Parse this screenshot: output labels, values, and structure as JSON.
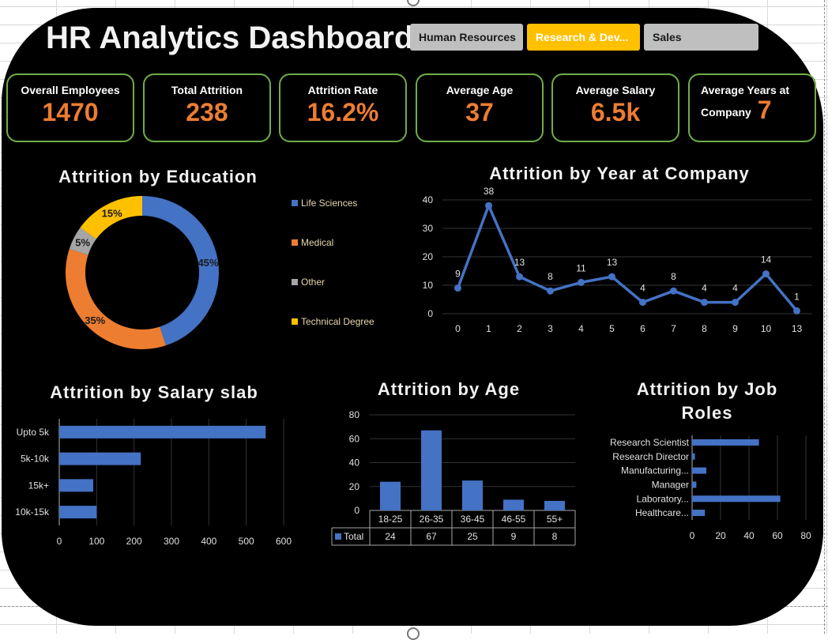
{
  "header": {
    "title": "HR Analytics Dashboard"
  },
  "slicer": {
    "items": [
      {
        "label": "Human Resources",
        "selected": false
      },
      {
        "label": "Research & Dev...",
        "selected": true
      },
      {
        "label": "Sales",
        "selected": false
      }
    ]
  },
  "kpis": {
    "overall_employees": {
      "label": "Overall Employees",
      "value": "1470"
    },
    "total_attrition": {
      "label": "Total Attrition",
      "value": "238"
    },
    "attrition_rate": {
      "label": "Attrition Rate",
      "value": "16.2%"
    },
    "average_age": {
      "label": "Average Age",
      "value": "37"
    },
    "average_salary": {
      "label": "Average Salary",
      "value": "6.5k"
    },
    "average_years": {
      "label": "Average Years at",
      "label2": "Company",
      "value": "7"
    }
  },
  "colors": {
    "accent_orange": "#ed7d31",
    "kpi_border": "#70ad47",
    "slicer_selected": "#ffc000",
    "slicer_unselected": "#bfbfbf",
    "series_blue": "#4472c4",
    "pie_orange": "#ed7d31",
    "pie_gray": "#a5a5a5",
    "pie_yellow": "#ffc000"
  },
  "chart_data": [
    {
      "id": "education",
      "type": "pie",
      "title": "Attrition by Education",
      "categories": [
        "Life Sciences",
        "Medical",
        "Other",
        "Technical Degree"
      ],
      "values": [
        45,
        35,
        5,
        15
      ],
      "labels": [
        "45%",
        "35%",
        "5%",
        "15%"
      ],
      "colors": [
        "#4472c4",
        "#ed7d31",
        "#a5a5a5",
        "#ffc000"
      ],
      "donut": true,
      "legend": "right"
    },
    {
      "id": "years",
      "type": "line",
      "title": "Attrition by Year at Company",
      "categories": [
        "0",
        "1",
        "2",
        "3",
        "4",
        "5",
        "6",
        "7",
        "8",
        "9",
        "10",
        "13"
      ],
      "values": [
        9,
        38,
        13,
        8,
        11,
        13,
        4,
        8,
        4,
        4,
        14,
        1
      ],
      "ylim": [
        0,
        40
      ],
      "yticks": [
        "0",
        "10",
        "20",
        "30",
        "40"
      ],
      "grid": true,
      "xlabel": "",
      "ylabel": ""
    },
    {
      "id": "salary",
      "type": "bar",
      "orientation": "horizontal",
      "title": "Attrition by Salary slab",
      "categories": [
        "Upto 5k",
        "5k-10k",
        "15k+",
        "10k-15k"
      ],
      "values": [
        552,
        218,
        91,
        100
      ],
      "xlim": [
        0,
        600
      ],
      "xticks": [
        "0",
        "100",
        "200",
        "300",
        "400",
        "500",
        "600"
      ],
      "grid": true
    },
    {
      "id": "age",
      "type": "bar",
      "title": "Attrition by Age",
      "categories": [
        "18-25",
        "26-35",
        "36-45",
        "46-55",
        "55+"
      ],
      "series": [
        {
          "name": "Total",
          "values": [
            24,
            67,
            25,
            9,
            8
          ]
        }
      ],
      "ylim": [
        0,
        80
      ],
      "yticks": [
        "0",
        "20",
        "40",
        "60",
        "80"
      ],
      "data_table": true,
      "grid": true
    },
    {
      "id": "jobroles",
      "type": "bar",
      "orientation": "horizontal",
      "title_line1": "Attrition by Job",
      "title_line2": "Roles",
      "categories": [
        "Research Scientist",
        "Research Director",
        "Manufacturing...",
        "Manager",
        "Laboratory...",
        "Healthcare..."
      ],
      "values": [
        47,
        2,
        10,
        3,
        62,
        9
      ],
      "xlim": [
        0,
        80
      ],
      "xticks": [
        "0",
        "20",
        "40",
        "60",
        "80"
      ],
      "grid": true
    }
  ]
}
